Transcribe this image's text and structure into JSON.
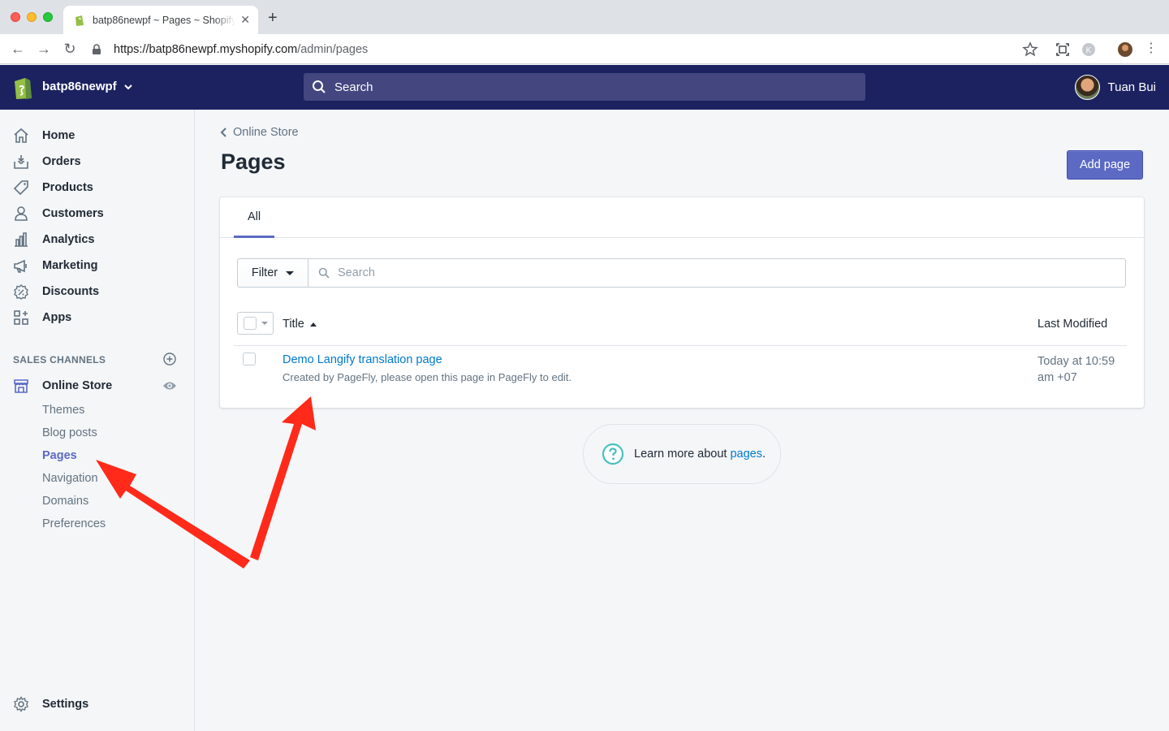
{
  "browser": {
    "tab_title": "batp86newpf ~ Pages ~ Shopify",
    "url_host": "https://batp86newpf.myshopify.com",
    "url_path": "/admin/pages"
  },
  "topbar": {
    "store_name": "batp86newpf",
    "search_placeholder": "Search",
    "user_name": "Tuan Bui"
  },
  "sidebar": {
    "items": [
      {
        "label": "Home",
        "icon": "home-icon"
      },
      {
        "label": "Orders",
        "icon": "orders-icon"
      },
      {
        "label": "Products",
        "icon": "tag-icon"
      },
      {
        "label": "Customers",
        "icon": "person-icon"
      },
      {
        "label": "Analytics",
        "icon": "bar-chart-icon"
      },
      {
        "label": "Marketing",
        "icon": "megaphone-icon"
      },
      {
        "label": "Discounts",
        "icon": "discount-icon"
      },
      {
        "label": "Apps",
        "icon": "apps-icon"
      }
    ],
    "sales_channels_title": "SALES CHANNELS",
    "online_store": "Online Store",
    "sub_items": [
      "Themes",
      "Blog posts",
      "Pages",
      "Navigation",
      "Domains",
      "Preferences"
    ],
    "settings": "Settings"
  },
  "main": {
    "breadcrumb": "Online Store",
    "title": "Pages",
    "add_button": "Add page",
    "tab_all": "All",
    "filter_label": "Filter",
    "search_placeholder": "Search",
    "col_title": "Title",
    "col_modified": "Last Modified",
    "rows": [
      {
        "title": "Demo Langify translation page",
        "subtitle": "Created by PageFly, please open this page in PageFly to edit.",
        "modified": "Today at 10:59 am +07"
      }
    ],
    "help_text": "Learn more about ",
    "help_link": "pages",
    "help_suffix": "."
  },
  "colors": {
    "topbar": "#1c2260",
    "accent": "#5c6ac4",
    "link": "#007ace",
    "annotation": "#ff2a1a"
  }
}
